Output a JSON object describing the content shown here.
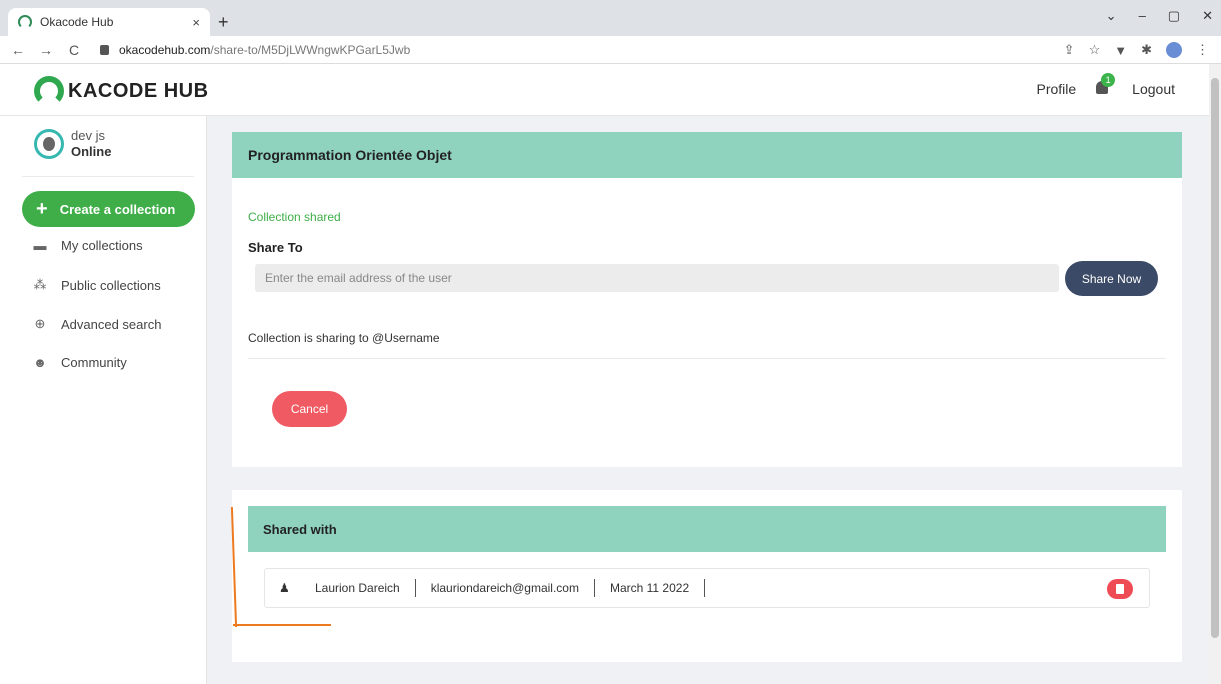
{
  "browser": {
    "tab_title": "Okacode Hub",
    "tab_close": "×",
    "new_tab": "+",
    "url_host": "okacodehub.com",
    "url_path": "/share-to/M5DjLWWngwKPGarL5Jwb",
    "window_controls": [
      "⌄",
      "–",
      "▢",
      "✕"
    ]
  },
  "header": {
    "logo_text": "KACODE HUB",
    "profile_label": "Profile",
    "notification_count": "1",
    "logout_label": "Logout"
  },
  "sidebar": {
    "user_name": "dev js",
    "user_status": "Online",
    "create_label": "Create a collection",
    "items": [
      {
        "label": "My collections",
        "icon": "folder-icon"
      },
      {
        "label": "Public collections",
        "icon": "cubes-icon"
      },
      {
        "label": "Advanced search",
        "icon": "search-plus-icon"
      },
      {
        "label": "Community",
        "icon": "users-icon"
      }
    ]
  },
  "share_card": {
    "title": "Programmation Orientée Objet",
    "success_message": "Collection shared",
    "share_to_label": "Share To",
    "email_placeholder": "Enter the email address of the user",
    "share_button": "Share Now",
    "sharing_text": "Collection is sharing to @Username",
    "cancel_button": "Cancel"
  },
  "shared_with": {
    "title": "Shared with",
    "rows": [
      {
        "name": "Laurion Dareich",
        "email": "klauriondareich@gmail.com",
        "date": "March 11 2022"
      }
    ]
  },
  "colors": {
    "accent_green": "#3fae48",
    "header_teal": "#8fd3bf",
    "share_button": "#3b4a66",
    "cancel_red": "#ef5a63",
    "annotation_orange": "#ee7a20"
  }
}
